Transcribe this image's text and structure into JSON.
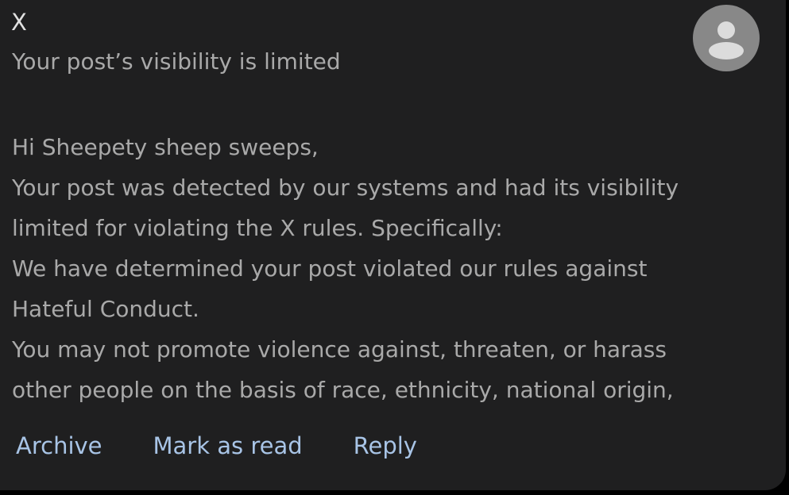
{
  "email": {
    "sender": "X",
    "subject": "Your post’s visibility is limited",
    "body_lines": [
      "Hi Sheepety sheep sweeps,",
      "Your post was detected by our systems and had its visibility",
      "limited for violating the X rules. Specifically:",
      "We have determined your post violated our rules against",
      "Hateful Conduct.",
      "You may not promote violence against, threaten, or harass",
      "other people on the basis of race, ethnicity, national origin,"
    ],
    "avatar_icon": "person-icon"
  },
  "actions": {
    "archive": "Archive",
    "mark_as_read": "Mark as read",
    "reply": "Reply"
  },
  "colors": {
    "card_background": "#1f1f20",
    "text_primary": "#e0e0e0",
    "text_secondary": "#a9a9a9",
    "action_link": "#a8c4e6",
    "avatar_background": "#888888"
  }
}
